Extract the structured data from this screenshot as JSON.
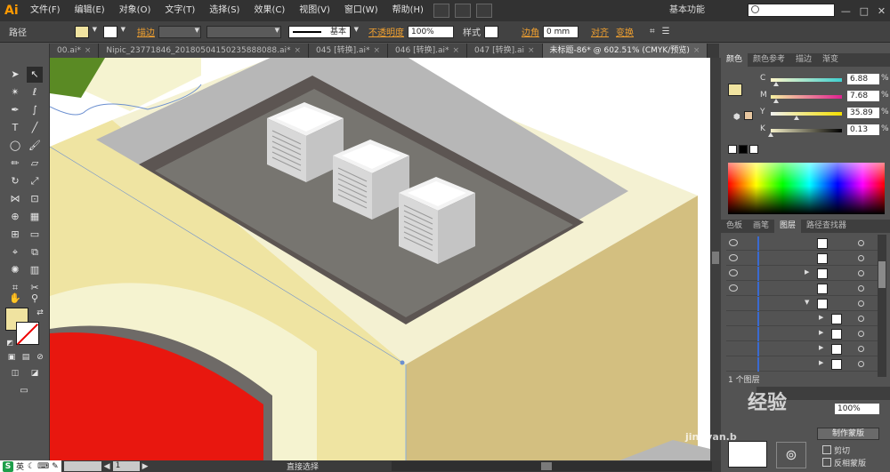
{
  "app": {
    "logo": "Ai",
    "workspace": "基本功能"
  },
  "menu": [
    "文件(F)",
    "编辑(E)",
    "对象(O)",
    "文字(T)",
    "选择(S)",
    "效果(C)",
    "视图(V)",
    "窗口(W)",
    "帮助(H)"
  ],
  "window_controls": {
    "minimize": "—",
    "maximize": "□",
    "close": "✕"
  },
  "control": {
    "object_type": "路径",
    "stroke_label": "描边",
    "stroke_style": "基本",
    "opacity_label": "不透明度",
    "opacity_value": "100%",
    "style_label": "样式",
    "corner_label": "边角",
    "corner_value": "0 mm",
    "align_label": "对齐",
    "transform_label": "变换"
  },
  "tabs": [
    {
      "label": "00.ai*",
      "active": false
    },
    {
      "label": "Nipic_23771846_20180504150235888088.ai*",
      "active": false
    },
    {
      "label": "045 [转换].ai*",
      "active": false
    },
    {
      "label": "046 [转换].ai*",
      "active": false
    },
    {
      "label": "047 [转换].ai",
      "active": false
    },
    {
      "label": "未标题-86* @ 602.51% (CMYK/预览)",
      "active": true
    }
  ],
  "colors": {
    "fill": "#f0e3a0",
    "stroke": "none",
    "accent": "#f0a030"
  },
  "color_panel": {
    "tabs": [
      "颜色",
      "颜色参考",
      "描边",
      "渐变"
    ],
    "channels": [
      {
        "name": "C",
        "value": "6.88",
        "percent": 6.88
      },
      {
        "name": "M",
        "value": "7.68",
        "percent": 7.68
      },
      {
        "name": "Y",
        "value": "35.89",
        "percent": 35.89
      },
      {
        "name": "K",
        "value": "0.13",
        "percent": 0.13
      }
    ],
    "unit": "%"
  },
  "layers_panel": {
    "tabs": [
      "色板",
      "画笔",
      "图层",
      "路径查找器"
    ],
    "count_label": "1 个图层"
  },
  "transparency_panel": {
    "percent": "100%",
    "make_mask": "制作蒙版",
    "clip": "剪切",
    "invert": "反相蒙版"
  },
  "status": {
    "ime": "英",
    "zoom_page": "1",
    "tool": "直接选择"
  },
  "watermark": {
    "brand": "经验",
    "url": "jingyan.b"
  }
}
